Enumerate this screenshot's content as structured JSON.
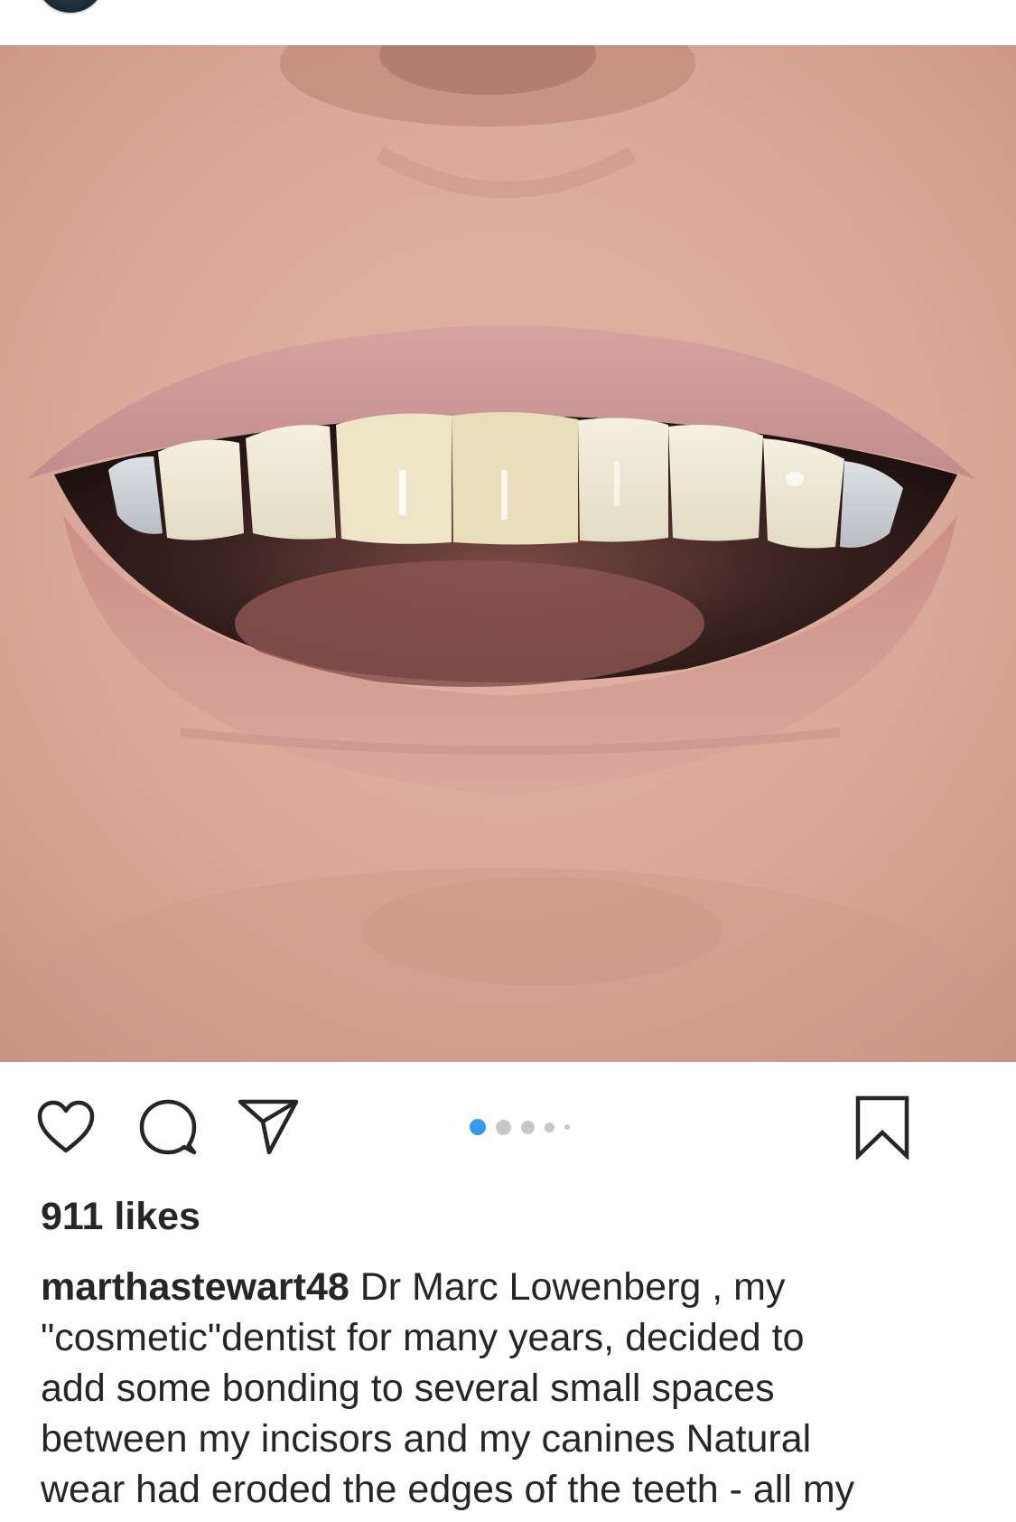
{
  "post": {
    "username": "marthastewart48",
    "likes_text": "911 likes",
    "caption_first": "Dr  Marc Lowenberg , my",
    "caption_lines": [
      "\"cosmetic\"dentist for many years, decided to",
      "add some bonding to several small spaces",
      "between my incisors and my canines  Natural",
      "wear had eroded the edges of the teeth - all my"
    ]
  },
  "carousel": {
    "total": 5,
    "active_index": 0
  },
  "icons": {
    "like": "heart-icon",
    "comment": "comment-bubble-icon",
    "share": "paper-plane-icon",
    "save": "bookmark-icon"
  },
  "colors": {
    "text": "#262626",
    "active_dot": "#3897f0",
    "inactive_dot": "#c7c7c7"
  }
}
